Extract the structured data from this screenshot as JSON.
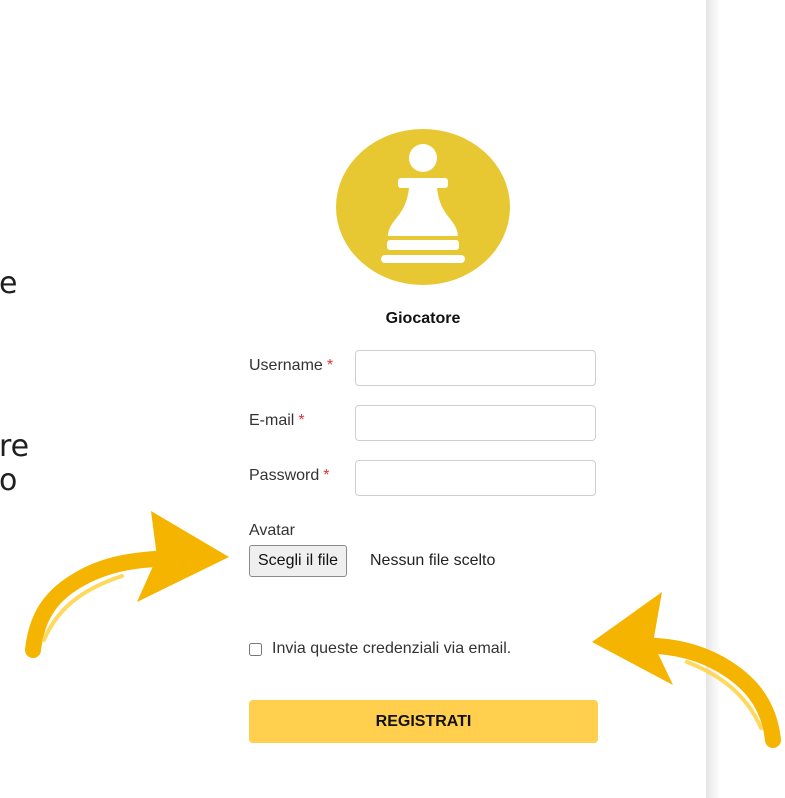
{
  "slide": {
    "cut_text_lines": [
      "e",
      "re",
      "o"
    ]
  },
  "form": {
    "role_title": "Giocatore",
    "required_marker": "*",
    "fields": {
      "username": {
        "label": "Username",
        "value": "",
        "placeholder": ""
      },
      "email": {
        "label": "E-mail",
        "value": "",
        "placeholder": ""
      },
      "password": {
        "label": "Password",
        "value": "",
        "placeholder": ""
      }
    },
    "avatar": {
      "label": "Avatar",
      "button_label": "Scegli il file",
      "status_text": "Nessun file scelto"
    },
    "checkbox": {
      "label": "Invia queste credenziali via email.",
      "checked": false
    },
    "submit_label": "REGISTRATI"
  },
  "icons": {
    "avatar_icon": "pawn-icon",
    "left_annotation": "curved-arrow-right-icon",
    "right_annotation": "curved-arrow-left-icon"
  },
  "colors": {
    "avatar_circle": "#E8C832",
    "submit_button": "#FFCF4D",
    "annotation_arrows": "#F5B400",
    "required_star": "#D63638"
  }
}
